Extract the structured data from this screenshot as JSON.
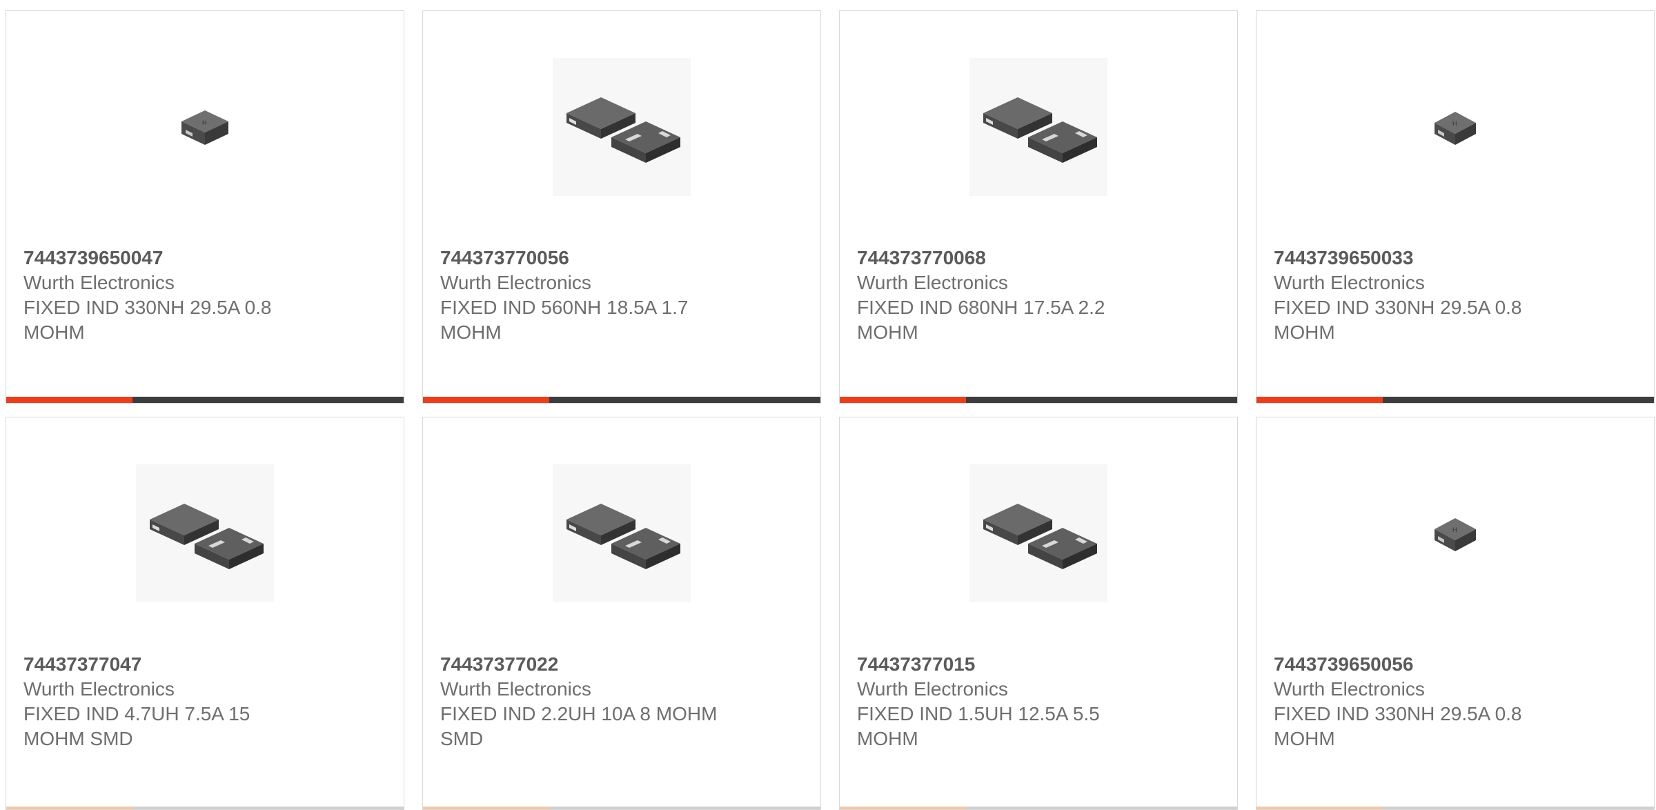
{
  "products": [
    {
      "part_number": "7443739650047",
      "manufacturer": "Wurth Electronics",
      "desc_line1": "FIXED IND 330NH 29.5A 0.8",
      "desc_line2": "MOHM",
      "image": "small-inductor-single"
    },
    {
      "part_number": "744373770056",
      "manufacturer": "Wurth Electronics",
      "desc_line1": "FIXED IND 560NH 18.5A 1.7",
      "desc_line2": "MOHM",
      "image": "inductor-pair"
    },
    {
      "part_number": "744373770068",
      "manufacturer": "Wurth Electronics",
      "desc_line1": "FIXED IND 680NH 17.5A 2.2",
      "desc_line2": "MOHM",
      "image": "inductor-pair"
    },
    {
      "part_number": "7443739650033",
      "manufacturer": "Wurth Electronics",
      "desc_line1": "FIXED IND 330NH 29.5A 0.8",
      "desc_line2": "MOHM",
      "image": "small-inductor-single"
    },
    {
      "part_number": "74437377047",
      "manufacturer": "Wurth Electronics",
      "desc_line1": "FIXED IND 4.7UH 7.5A 15",
      "desc_line2": "MOHM SMD",
      "image": "inductor-pair"
    },
    {
      "part_number": "74437377022",
      "manufacturer": "Wurth Electronics",
      "desc_line1": "FIXED IND 2.2UH 10A 8 MOHM",
      "desc_line2": "SMD",
      "image": "inductor-pair"
    },
    {
      "part_number": "74437377015",
      "manufacturer": "Wurth Electronics",
      "desc_line1": "FIXED IND 1.5UH 12.5A 5.5",
      "desc_line2": "MOHM",
      "image": "inductor-pair"
    },
    {
      "part_number": "7443739650056",
      "manufacturer": "Wurth Electronics",
      "desc_line1": "FIXED IND 330NH 29.5A 0.8",
      "desc_line2": "MOHM",
      "image": "small-inductor-single"
    }
  ],
  "colors": {
    "accent": "#e8401e",
    "bar": "#3d3d3d",
    "text": "#6e6e6e",
    "border": "#d9d9d9"
  }
}
